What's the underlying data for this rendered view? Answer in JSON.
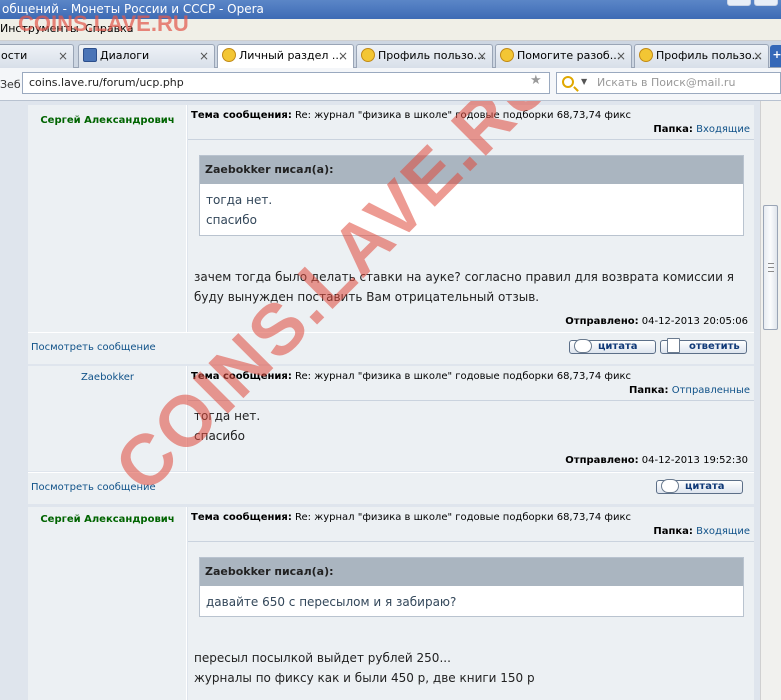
{
  "window": {
    "title": "общений - Монеты России и СССР - Opera"
  },
  "watermark": {
    "top_left": "COINS.LAVE.RU",
    "diagonal": "COINS.LAVE.RU"
  },
  "menu": {
    "items": [
      "Инструменты",
      "Справка"
    ]
  },
  "tabs": [
    {
      "label": "ости",
      "icon": "page-icon"
    },
    {
      "label": "Диалоги",
      "icon": "dialog-icon"
    },
    {
      "label": "Личный раздел ...",
      "icon": "smiley-icon",
      "active": true
    },
    {
      "label": "Профиль пользо...",
      "icon": "smiley-icon"
    },
    {
      "label": "Помогите разоб...",
      "icon": "smiley-icon"
    },
    {
      "label": "Профиль пользо...",
      "icon": "smiley-icon"
    }
  ],
  "address": {
    "left_label": "Зеб",
    "url": "coins.lave.ru/forum/ucp.php",
    "search_placeholder": "Искать в Поиск@mail.ru"
  },
  "messages": [
    {
      "author": "Сергей Александрович",
      "subject_label": "Тема сообщения:",
      "subject": "Re: журнал \"физика в школе\" годовые подборки 68,73,74 фикс",
      "folder_label": "Папка:",
      "folder": "Входящие",
      "quote_author": "Zaebokker писал(а):",
      "quote_lines": [
        "тогда нет.",
        "спасибо"
      ],
      "body_lines": [
        "зачем тогда было делать ставки на ауке? согласно правил для возврата комиссии я",
        "буду вынужден поставить Вам отрицательный отзыв."
      ],
      "sent_label": "Отправлено:",
      "sent": "04-12-2013 20:05:06",
      "view_link": "Посмотреть сообщение",
      "quote_button": "цитата",
      "reply_button": "ответить"
    },
    {
      "author": "Zaebokker",
      "subject_label": "Тема сообщения:",
      "subject": "Re: журнал \"физика в школе\" годовые подборки 68,73,74 фикс",
      "folder_label": "Папка:",
      "folder": "Отправленные",
      "body_lines": [
        "тогда нет.",
        "спасибо"
      ],
      "sent_label": "Отправлено:",
      "sent": "04-12-2013 19:52:30",
      "view_link": "Посмотреть сообщение",
      "quote_button": "цитата"
    },
    {
      "author": "Сергей Александрович",
      "subject_label": "Тема сообщения:",
      "subject": "Re: журнал \"физика в школе\" годовые подборки 68,73,74 фикс",
      "folder_label": "Папка:",
      "folder": "Входящие",
      "quote_author": "Zaebokker писал(а):",
      "quote_lines": [
        "давайте 650 с пересылом и я забираю?"
      ],
      "body_lines": [
        "пересыл посылкой выйдет рублей 250...",
        "журналы по фиксу как и были 450 р, две книги 150 р"
      ]
    }
  ]
}
